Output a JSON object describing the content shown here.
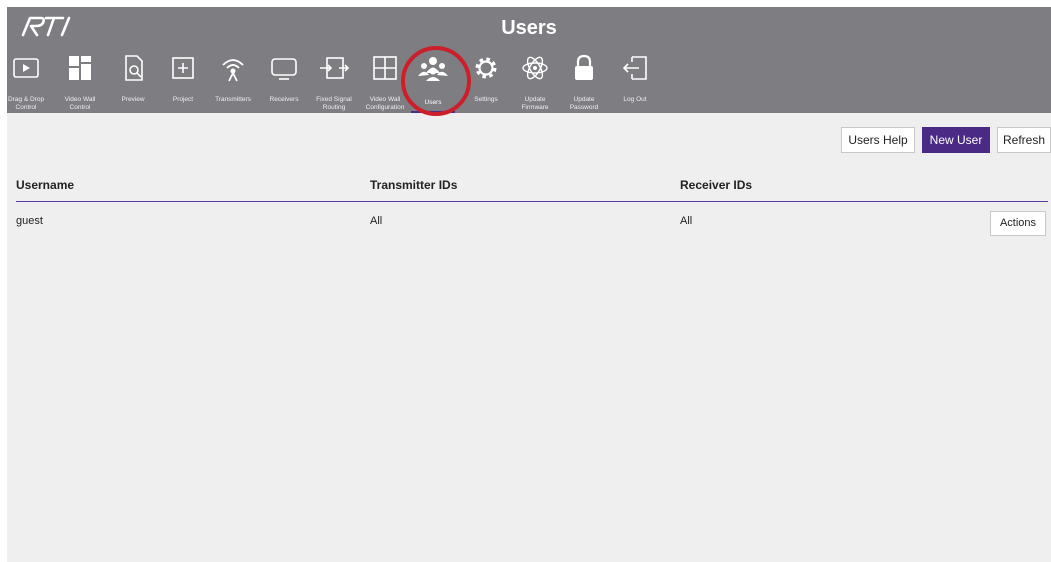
{
  "header": {
    "title": "Users",
    "logo_text": "RTI"
  },
  "nav": {
    "items": [
      {
        "label": "Drag & Drop\nControl",
        "icon": "play-screen-icon"
      },
      {
        "label": "Video Wall\nControl",
        "icon": "video-wall-grid-icon"
      },
      {
        "label": "Preview",
        "icon": "preview-document-icon"
      },
      {
        "label": "Project",
        "icon": "project-plus-icon"
      },
      {
        "label": "Transmitters",
        "icon": "transmitter-antenna-icon"
      },
      {
        "label": "Receivers",
        "icon": "receiver-monitor-icon"
      },
      {
        "label": "Fixed Signal\nRouting",
        "icon": "signal-routing-icon"
      },
      {
        "label": "Video Wall\nConfiguration",
        "icon": "video-wall-config-icon"
      },
      {
        "label": "Users",
        "icon": "users-icon"
      },
      {
        "label": "Settings",
        "icon": "gear-icon"
      },
      {
        "label": "Update\nFirmware",
        "icon": "atom-firmware-icon"
      },
      {
        "label": "Update\nPassword",
        "icon": "lock-icon"
      },
      {
        "label": "Log Out",
        "icon": "logout-icon"
      }
    ],
    "active_label": "Users"
  },
  "toolbar": {
    "help_label": "Users Help",
    "new_label": "New User",
    "refresh_label": "Refresh"
  },
  "table": {
    "columns": [
      "Username",
      "Transmitter IDs",
      "Receiver IDs"
    ],
    "rows": [
      {
        "username": "guest",
        "transmitters": "All",
        "receivers": "All",
        "action_label": "Actions"
      }
    ]
  },
  "colors": {
    "topbar": "#7d7d82",
    "accent": "#4b2a85",
    "highlight": "#cc1f2a",
    "content_bg": "#efefef"
  }
}
